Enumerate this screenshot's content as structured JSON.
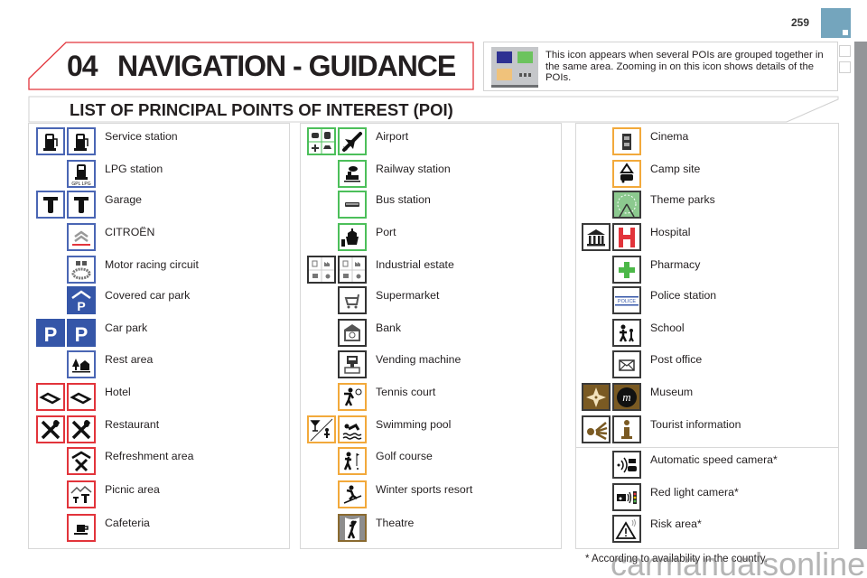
{
  "page": {
    "number": "259",
    "chapter_number": "04",
    "chapter_title": "NAVIGATION - GUIDANCE",
    "section_title": "LIST OF PRINCIPAL POINTS OF INTEREST (POI)",
    "accent_color": "#e2343b",
    "tab_color": "#74a5bd"
  },
  "note": {
    "icon": "grouped-poi-icon",
    "text": "This icon appears when several POIs are grouped together in the same area. Zooming in on this icon shows details of the POIs."
  },
  "columns": [
    {
      "items": [
        {
          "label": "Service station",
          "icons": [
            "fuel-pump-icon",
            "fuel-pump-icon"
          ]
        },
        {
          "label": "LPG station",
          "icons": [
            "lpg-pump-icon"
          ]
        },
        {
          "label": "Garage",
          "icons": [
            "wrench-icon",
            "wrench-icon"
          ]
        },
        {
          "label": "CITROËN",
          "icons": [
            "citroen-logo-icon"
          ]
        },
        {
          "label": "Motor racing circuit",
          "icons": [
            "racing-circuit-icon"
          ]
        },
        {
          "label": "Covered car park",
          "icons": [
            "covered-parking-icon"
          ]
        },
        {
          "label": "Car park",
          "icons": [
            "parking-icon",
            "parking-icon"
          ]
        },
        {
          "label": "Rest area",
          "icons": [
            "rest-area-icon"
          ]
        },
        {
          "label": "Hotel",
          "icons": [
            "bed-icon",
            "bed-icon"
          ]
        },
        {
          "label": "Restaurant",
          "icons": [
            "fork-spoon-icon",
            "fork-spoon-icon"
          ]
        },
        {
          "label": "Refreshment area",
          "icons": [
            "refreshment-icon"
          ]
        },
        {
          "label": "Picnic area",
          "icons": [
            "picnic-icon"
          ]
        },
        {
          "label": "Cafeteria",
          "icons": [
            "coffee-cup-icon"
          ]
        }
      ]
    },
    {
      "items": [
        {
          "label": "Airport",
          "icons": [
            "transport-group-icon",
            "airplane-icon"
          ]
        },
        {
          "label": "Railway station",
          "icons": [
            "train-icon"
          ]
        },
        {
          "label": "Bus station",
          "icons": [
            "bus-icon"
          ]
        },
        {
          "label": "Port",
          "icons": [
            "ship-icon"
          ]
        },
        {
          "label": "Industrial estate",
          "icons": [
            "industry-group-icon",
            "industry-group-icon"
          ]
        },
        {
          "label": "Supermarket",
          "icons": [
            "shopping-cart-icon"
          ]
        },
        {
          "label": "Bank",
          "icons": [
            "bank-icon"
          ]
        },
        {
          "label": "Vending machine",
          "icons": [
            "vending-machine-icon"
          ]
        },
        {
          "label": "Tennis court",
          "icons": [
            "tennis-icon"
          ]
        },
        {
          "label": "Swimming pool",
          "icons": [
            "leisure-group-icon",
            "swimmer-icon"
          ]
        },
        {
          "label": "Golf course",
          "icons": [
            "golf-icon"
          ]
        },
        {
          "label": "Winter sports resort",
          "icons": [
            "skier-icon"
          ]
        },
        {
          "label": "Theatre",
          "icons": [
            "theatre-icon"
          ]
        }
      ]
    },
    {
      "items": [
        {
          "label": "Cinema",
          "icons": [
            "film-icon"
          ]
        },
        {
          "label": "Camp site",
          "icons": [
            "camp-site-icon"
          ]
        },
        {
          "label": "Theme parks",
          "icons": [
            "ferris-wheel-icon"
          ]
        },
        {
          "label": "Hospital",
          "icons": [
            "public-building-icon",
            "hospital-icon"
          ]
        },
        {
          "label": "Pharmacy",
          "icons": [
            "pharmacy-cross-icon"
          ]
        },
        {
          "label": "Police station",
          "icons": [
            "police-icon"
          ]
        },
        {
          "label": "School",
          "icons": [
            "school-children-icon"
          ]
        },
        {
          "label": "Post office",
          "icons": [
            "envelope-icon"
          ]
        },
        {
          "label": "Museum",
          "icons": [
            "monument-icon",
            "museum-icon"
          ]
        },
        {
          "label": "Tourist information",
          "icons": [
            "tourist-sight-icon",
            "information-icon"
          ]
        },
        {
          "label": "Automatic speed camera*",
          "icons": [
            "speed-camera-icon"
          ]
        },
        {
          "label": "Red light camera*",
          "icons": [
            "red-light-camera-icon"
          ]
        },
        {
          "label": "Risk area*",
          "icons": [
            "risk-area-icon"
          ]
        }
      ]
    }
  ],
  "police_text": "POLICE",
  "lpg_text": "GPL LPG",
  "footnote": "* According to availability in the country.",
  "watermark": "carmanualsonline.info"
}
